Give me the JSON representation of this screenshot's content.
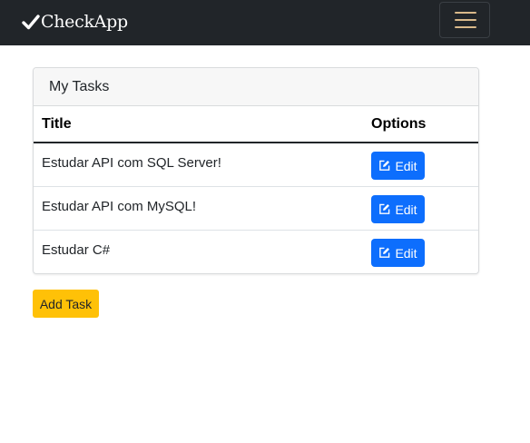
{
  "navbar": {
    "brand": "CheckApp",
    "brand_icon": "check-icon",
    "toggler_icon": "hamburger-menu-icon"
  },
  "card": {
    "header": "My Tasks",
    "columns": [
      "Title",
      "Options"
    ],
    "rows": [
      {
        "title": "Estudar API com SQL Server!",
        "action": "Edit",
        "icon": "edit-icon"
      },
      {
        "title": "Estudar API com MySQL!",
        "action": "Edit",
        "icon": "edit-icon"
      },
      {
        "title": "Estudar C#",
        "action": "Edit",
        "icon": "edit-icon"
      }
    ]
  },
  "add_button": "Add Task",
  "colors": {
    "navbar": "#212529",
    "primary": "#0d6efd",
    "warning": "#ffc107",
    "header_bg": "#f7f7f7"
  }
}
